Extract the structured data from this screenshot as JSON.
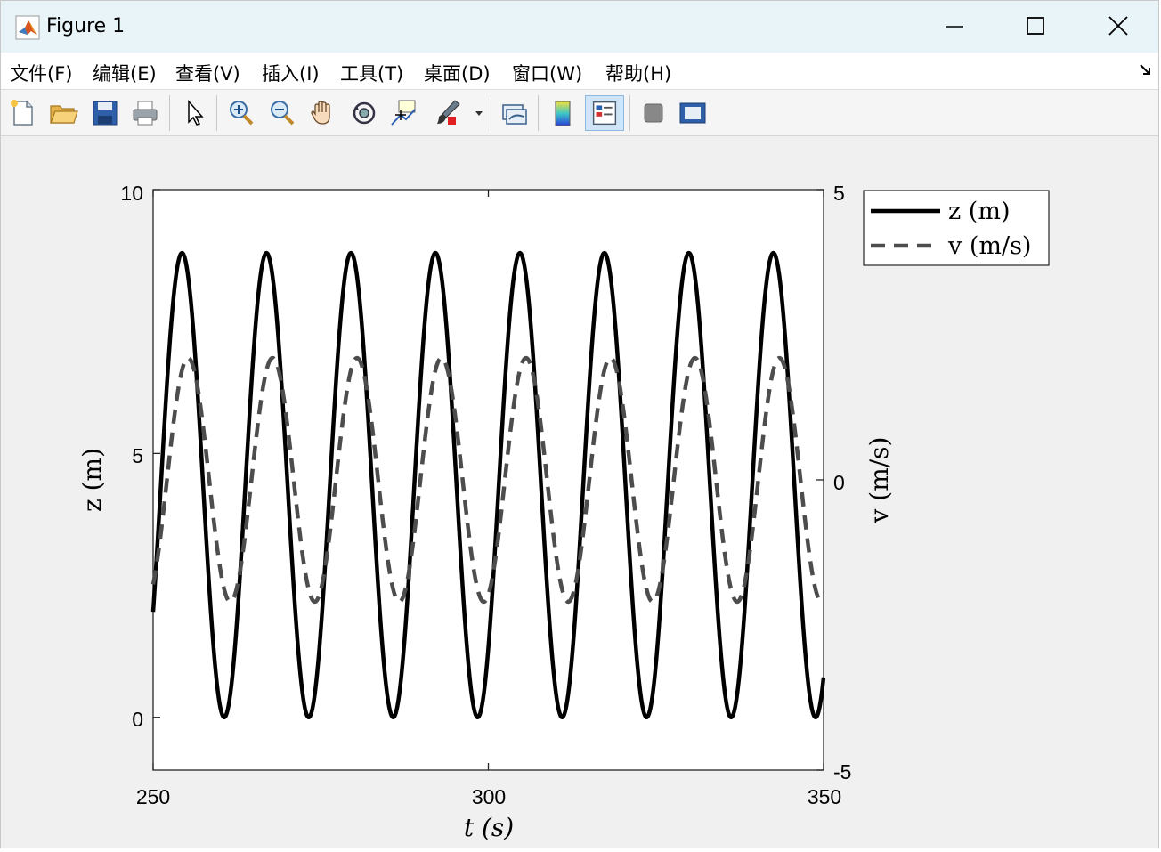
{
  "window": {
    "title": "Figure 1"
  },
  "menu": [
    "文件(F)",
    "编辑(E)",
    "查看(V)",
    "插入(I)",
    "工具(T)",
    "桌面(D)",
    "窗口(W)",
    "帮助(H)"
  ],
  "toolbar": {
    "icons": [
      "new-figure-icon",
      "open-folder-icon",
      "save-icon",
      "print-icon",
      "pointer-icon",
      "zoom-in-icon",
      "zoom-out-icon",
      "pan-hand-icon",
      "rotate-3d-icon",
      "data-cursor-icon",
      "brush-icon",
      "brush-dropdown-icon",
      "link-plot-icon",
      "colorbar-icon",
      "legend-icon",
      "hide-plot-tools-icon",
      "show-plot-tools-icon"
    ]
  },
  "chart_data": {
    "type": "line",
    "title": "",
    "xlabel": "t (s)",
    "ylabel_left": "z (m)",
    "ylabel_right": "v (m/s)",
    "xlim": [
      250,
      350
    ],
    "ylim_left": [
      -1,
      10
    ],
    "ylim_right": [
      -5,
      5
    ],
    "x_ticks": [
      "250",
      "300",
      "350"
    ],
    "y_ticks_left": [
      "0",
      "5",
      "10"
    ],
    "y_ticks_right": [
      "-5",
      "0",
      "5"
    ],
    "legend": {
      "placement": "outside-top-right",
      "entries": [
        "z (m)",
        "v (m/s)"
      ]
    },
    "series": [
      {
        "name": "z (m)",
        "axis": "left",
        "style": "solid",
        "color": "#000000",
        "t_start": 250,
        "t_end": 350,
        "period": 12.6,
        "offset": 4.4,
        "amplitude": 4.4,
        "value_at_start": 2.0,
        "min": 0.0,
        "max": 8.8
      },
      {
        "name": "v (m/s)",
        "axis": "right",
        "style": "dashed",
        "color": "#4d4d4d",
        "t_start": 250,
        "t_end": 350,
        "period": 12.6,
        "offset": 0.0,
        "amplitude": 2.1,
        "value_at_start": -1.8,
        "min": -2.1,
        "max": 2.1
      }
    ]
  }
}
